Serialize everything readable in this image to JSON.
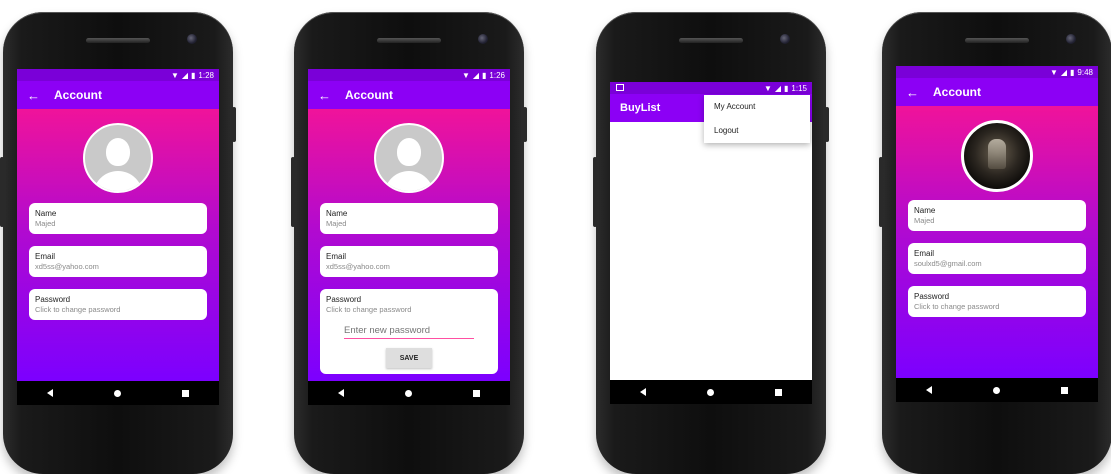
{
  "phones": [
    {
      "time": "1:28",
      "title": "Account",
      "fields": [
        {
          "label": "Name",
          "value": "Majed"
        },
        {
          "label": "Email",
          "value": "xd5ss@yahoo.com"
        },
        {
          "label": "Password",
          "value": "Click to change password"
        }
      ]
    },
    {
      "time": "1:26",
      "title": "Account",
      "fields": [
        {
          "label": "Name",
          "value": "Majed"
        },
        {
          "label": "Email",
          "value": "xd5ss@yahoo.com"
        },
        {
          "label": "Password",
          "value": "Click to change password"
        }
      ],
      "password_placeholder": "Enter new password",
      "save_label": "SAVE"
    },
    {
      "time": "1:15",
      "title": "BuyList",
      "menu": [
        "My Account",
        "Logout"
      ]
    },
    {
      "time": "9:48",
      "title": "Account",
      "fields": [
        {
          "label": "Name",
          "value": "Majed"
        },
        {
          "label": "Email",
          "value": "soulxd5@gmail.com"
        },
        {
          "label": "Password",
          "value": "Click to change password"
        }
      ]
    }
  ],
  "colors": {
    "appbar": "#8c00f5",
    "status": "#7a00d8",
    "gradient_top": "#f0139a",
    "gradient_bottom": "#7c00ff"
  },
  "icons": {
    "status": [
      "wifi-icon",
      "signal-icon",
      "battery-icon"
    ],
    "nav": [
      "back-nav-icon",
      "home-nav-icon",
      "recents-nav-icon"
    ]
  }
}
